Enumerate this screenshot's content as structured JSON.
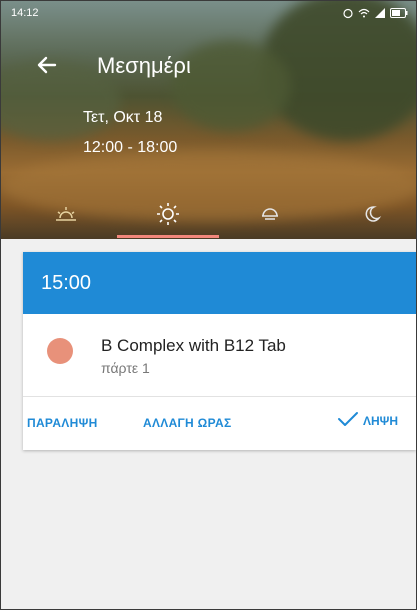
{
  "status_bar": {
    "time": "14:12"
  },
  "header": {
    "title": "Μεσημέρι",
    "date": "Τετ, Οκτ 18",
    "time_range": "12:00 - 18:00"
  },
  "tabs": [
    {
      "icon": "sunrise-icon",
      "selected": false
    },
    {
      "icon": "sun-icon",
      "selected": true
    },
    {
      "icon": "sunset-icon",
      "selected": false
    },
    {
      "icon": "moon-icon",
      "selected": false
    }
  ],
  "reminder": {
    "time": "15:00",
    "medication": {
      "name": "B Complex with B12 Tab",
      "dose": "πάρτε 1",
      "pill_color": "#e8917a"
    },
    "actions": {
      "skip_label": "ΠΑΡΑΛΗΨΗ",
      "reschedule_label": "ΑΛΛΑΓΗ ΩΡΑΣ",
      "take_label": "ΛΗΨΗ"
    }
  },
  "colors": {
    "accent": "#1f8ad6",
    "tab_indicator": "#f2877c"
  }
}
